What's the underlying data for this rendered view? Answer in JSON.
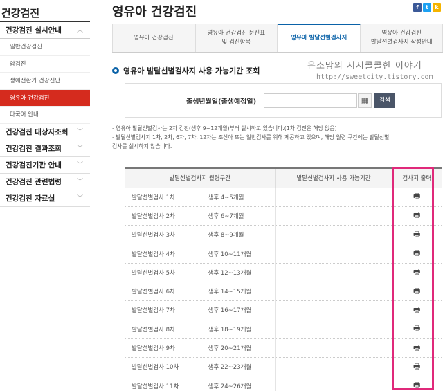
{
  "sidebar": {
    "title": "건강검진",
    "menus": [
      {
        "label": "건강검진 실시안내",
        "chev": "︿",
        "open": true
      },
      {
        "label": "건강검진 대상자조회",
        "chev": "﹀"
      },
      {
        "label": "건강검진 결과조회",
        "chev": "﹀"
      },
      {
        "label": "건강검진기관 안내",
        "chev": "﹀"
      },
      {
        "label": "건강검진 관련법령",
        "chev": "﹀"
      },
      {
        "label": "건강검진 자료실",
        "chev": "﹀"
      }
    ],
    "sub_items": [
      "일반건강검진",
      "암검진",
      "생애전환기 건강진단",
      "영유아 건강검진",
      "다국어 안내"
    ],
    "active_sub": "영유아 건강검진"
  },
  "header": {
    "title": "영유아 건강검진",
    "social": [
      "f",
      "t",
      "k"
    ]
  },
  "tabs": [
    {
      "label": "영유아 건강검진"
    },
    {
      "label": "영유아 건강검진 문진표\n및 검진항목"
    },
    {
      "label": "영유아 발달선별검사지",
      "active": true
    },
    {
      "label": "영유아 건강검진\n발달선별검사지 작성안내"
    }
  ],
  "section": {
    "title": "영유아 발달선별검사지 사용 가능기간 조회"
  },
  "watermark": {
    "text": "은소망의 시시콜콜한 이야기",
    "url": "http://sweetcity.tistory.com"
  },
  "search": {
    "label": "출생년월일(출생예정일)",
    "input_value": "",
    "button_label": "검색"
  },
  "notes": [
    "- 영유아 발달선별검사는 2차 검진(생후 9~12개월)부터 실시하고 있습니다.(1차 검진은 해당 없음)",
    "- 발달선별검사지 1차, 2차, 6차, 7차, 12차는 조산아 또는 일반검사를 위해 제공하고 있으며, 해당 월령 구간에는 발달선별",
    "  검사를 실시하지 않습니다."
  ],
  "table": {
    "headers": [
      "발달선별검사지 월령구간",
      "발달선별검사지 사용 가능기간",
      "검사지 출력"
    ],
    "rows": [
      {
        "name": "발달선별검사 1차",
        "period": "생후 4~5개월",
        "available": ""
      },
      {
        "name": "발달선별검사 2차",
        "period": "생후 6~7개월",
        "available": ""
      },
      {
        "name": "발달선별검사 3차",
        "period": "생후 8~9개월",
        "available": ""
      },
      {
        "name": "발달선별검사 4차",
        "period": "생후 10~11개월",
        "available": ""
      },
      {
        "name": "발달선별검사 5차",
        "period": "생후 12~13개월",
        "available": ""
      },
      {
        "name": "발달선별검사 6차",
        "period": "생후 14~15개월",
        "available": ""
      },
      {
        "name": "발달선별검사 7차",
        "period": "생후 16~17개월",
        "available": ""
      },
      {
        "name": "발달선별검사 8차",
        "period": "생후 18~19개월",
        "available": ""
      },
      {
        "name": "발달선별검사 9차",
        "period": "생후 20~21개월",
        "available": ""
      },
      {
        "name": "발달선별검사 10차",
        "period": "생후 22~23개월",
        "available": ""
      },
      {
        "name": "발달선별검사 11차",
        "period": "생후 24~26개월",
        "available": ""
      }
    ],
    "print_icon": "printer-icon",
    "highlight_color": "#e0297a"
  }
}
